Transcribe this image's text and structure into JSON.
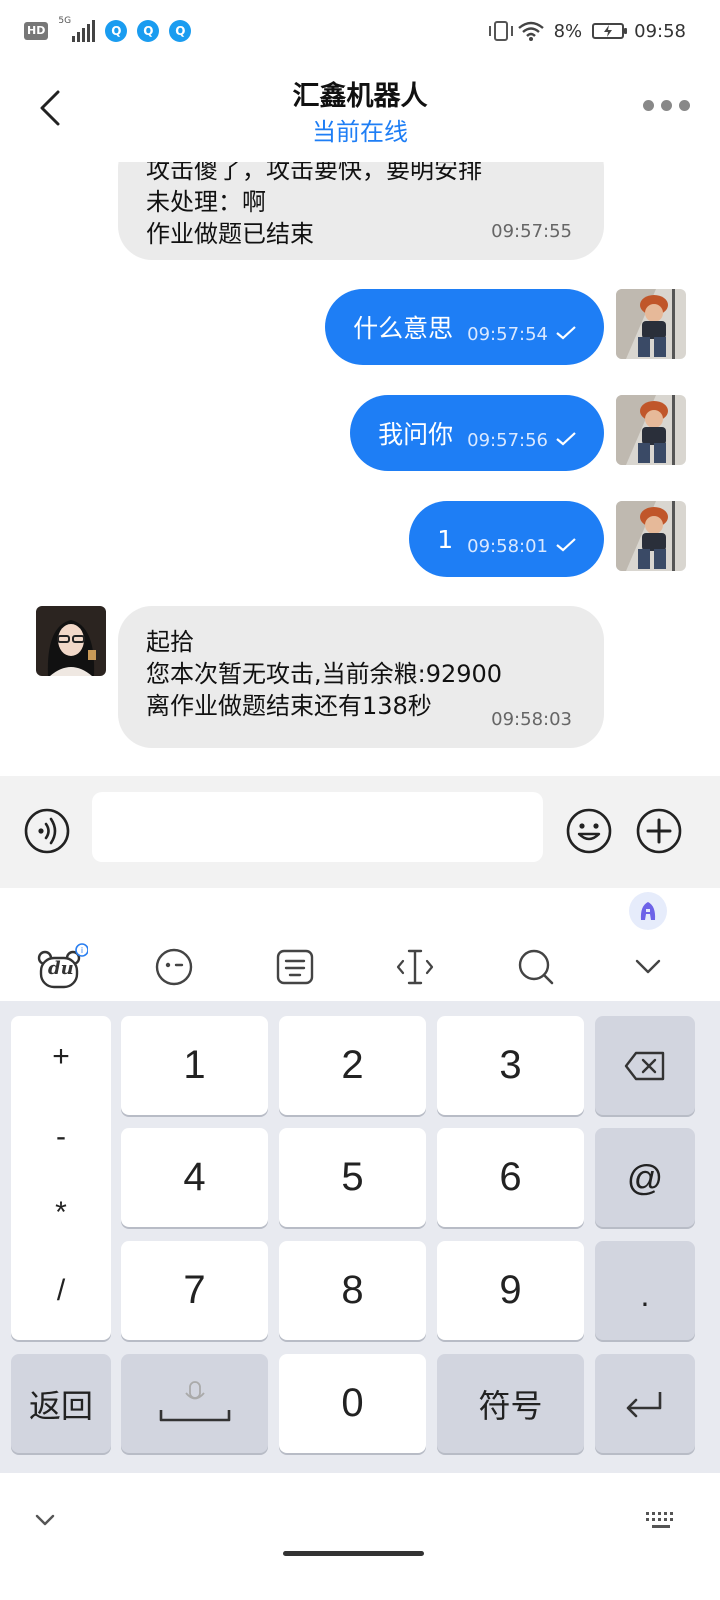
{
  "status_bar": {
    "hd": "HD",
    "network": "5G",
    "qq_icons": [
      "Q",
      "Q",
      "Q"
    ],
    "battery_percent": "8%",
    "time": "09:58"
  },
  "header": {
    "title": "汇鑫机器人",
    "subtitle": "当前在线"
  },
  "messages": {
    "bot_prev": {
      "lines": [
        "攻击傻了，攻击要快，要明安排",
        "未处理：啊",
        "作业做题已结束"
      ],
      "time": "09:57:55"
    },
    "me_1": {
      "text": "什么意思",
      "time": "09:57:54"
    },
    "me_2": {
      "text": "我问你",
      "time": "09:57:56"
    },
    "me_3": {
      "text": "1",
      "time": "09:58:01"
    },
    "bot_last": {
      "lines": [
        "起拾",
        "您本次暂无攻击,当前余粮:92900",
        "离作业做题结束还有138秒"
      ],
      "time": "09:58:03"
    }
  },
  "input": {
    "value": "",
    "placeholder": ""
  },
  "keyboard": {
    "side_symbols": [
      "+",
      "-",
      "*",
      "/"
    ],
    "digits": [
      "1",
      "2",
      "3",
      "4",
      "5",
      "6",
      "7",
      "8",
      "9",
      "0"
    ],
    "at_key": "@",
    "dot_key": ".",
    "back_key": "返回",
    "symbol_key": "符号",
    "du_label": "du",
    "ai_label": "A"
  },
  "colors": {
    "accent": "#1e7ef5",
    "bubble_in": "#ebebeb",
    "keyboard_bg": "#e8eaf0"
  }
}
